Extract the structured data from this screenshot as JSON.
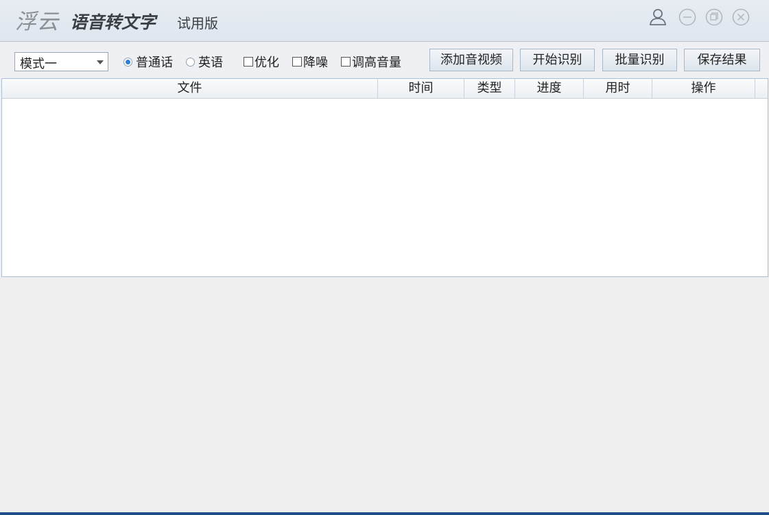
{
  "titlebar": {
    "brand": "浮云",
    "app_title": "语音转文字",
    "edition": "试用版",
    "icons": [
      "user-icon",
      "minimize-icon",
      "restore-icon",
      "close-icon"
    ]
  },
  "toolbar": {
    "mode_select": {
      "value": "模式一"
    },
    "language": {
      "options": [
        "普通话",
        "英语"
      ],
      "selected": "普通话"
    },
    "checkboxes": [
      {
        "label": "优化",
        "checked": false
      },
      {
        "label": "降噪",
        "checked": false
      },
      {
        "label": "调高音量",
        "checked": false
      }
    ],
    "buttons": {
      "add_media": "添加音视频",
      "start": "开始识别",
      "batch": "批量识别",
      "save": "保存结果"
    }
  },
  "table": {
    "columns": [
      "文件",
      "时间",
      "类型",
      "进度",
      "用时",
      "操作"
    ],
    "rows": []
  },
  "colors": {
    "accent": "#2d7fd8",
    "titlebar": "#e3e9f0",
    "bottom_strip": "#1f4f8a"
  }
}
